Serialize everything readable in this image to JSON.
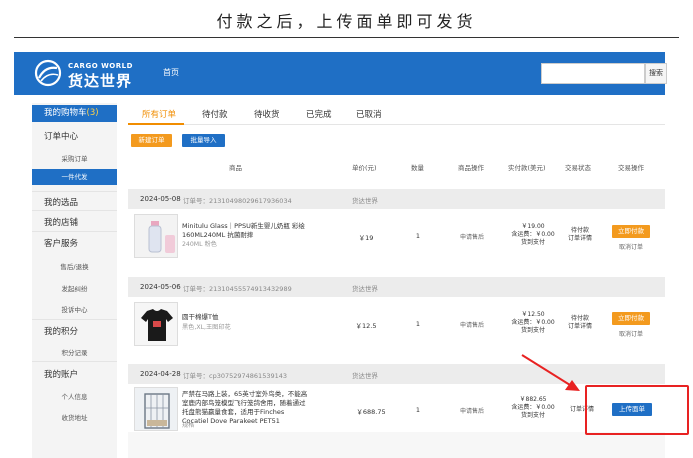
{
  "caption": "付款之后，上传面单即可发货",
  "header": {
    "logo_en": "CARGO WORLD",
    "logo_cn": "货达世界",
    "nav_home": "首页",
    "search_placeholder": "",
    "search_button": "搜索",
    "brand_color": "#1f6fc5"
  },
  "sidebar": {
    "cart_label": "我的购物车",
    "cart_count": "(3)",
    "order_center": "订单中心",
    "purchase_order": "采购订单",
    "dropship": "一件代发",
    "my_picks": "我的选品",
    "my_store": "我的店铺",
    "customer_service": "客户服务",
    "after_sales": "售后/退换",
    "disputes": "发起纠纷",
    "complaints": "投诉中心",
    "my_points": "我的积分",
    "points_record": "积分记录",
    "my_account": "我的账户",
    "personal_info": "个人信息",
    "shipping_address": "收货地址"
  },
  "tabs": [
    "所有订单",
    "待付款",
    "待收货",
    "已完成",
    "已取消"
  ],
  "actions": {
    "new_order": "新建订单",
    "bulk_import": "批量导入"
  },
  "table_headers": {
    "product": "商品",
    "unit_price": "单价(元)",
    "quantity": "数量",
    "product_ops": "商品操作",
    "paid": "实付款(美元)",
    "status": "交易状态",
    "ops": "交易操作"
  },
  "orders": [
    {
      "date": "2024-05-08",
      "order_no": "订单号：21310498029617936034",
      "seller": "货达世界",
      "title": "Minitulu Glass｜PPSU新生婴儿奶瓶 彩绘160ML240ML 抗菌耐摔",
      "spec": "240ML 粉色",
      "price": "￥19",
      "qty": "1",
      "product_op": "申请售后",
      "paid_total": "￥19.00",
      "paid_shipping": "含运费：￥0.00",
      "paid_note": "货到支付",
      "status_line1": "待付款",
      "status_line2": "订单详情",
      "primary_action": "立即付款",
      "secondary_action": "取消订单"
    },
    {
      "date": "2024-05-06",
      "order_no": "订单号：21310455574913432989",
      "seller": "货达世界",
      "title": "圆干棉爆T恤",
      "spec": "黑色,XL,王图印花",
      "price": "￥12.5",
      "qty": "1",
      "product_op": "申请售后",
      "paid_total": "￥12.50",
      "paid_shipping": "含运费：￥0.00",
      "paid_note": "货到支付",
      "status_line1": "待付款",
      "status_line2": "订单详情",
      "primary_action": "立即付款",
      "secondary_action": "取消订单"
    },
    {
      "date": "2024-04-28",
      "order_no": "订单号：cp30752974861539143",
      "seller": "货达世界",
      "title": "严禁在马路上装，65英寸室外鸟类，不能高室鹿内部鸟笼模型飞行笼鸽舍用，随着通过托盘熊猫赢量食套，适用于Finches Cocatiel Dove Parakeet PET51",
      "spec": "规格",
      "price": "￥688.75",
      "qty": "1",
      "product_op": "申请售后",
      "paid_total": "￥882.65",
      "paid_shipping": "含运费：￥0.00",
      "paid_note": "货到支付",
      "status_line1": "订单详情",
      "primary_action": "上传面单"
    }
  ]
}
